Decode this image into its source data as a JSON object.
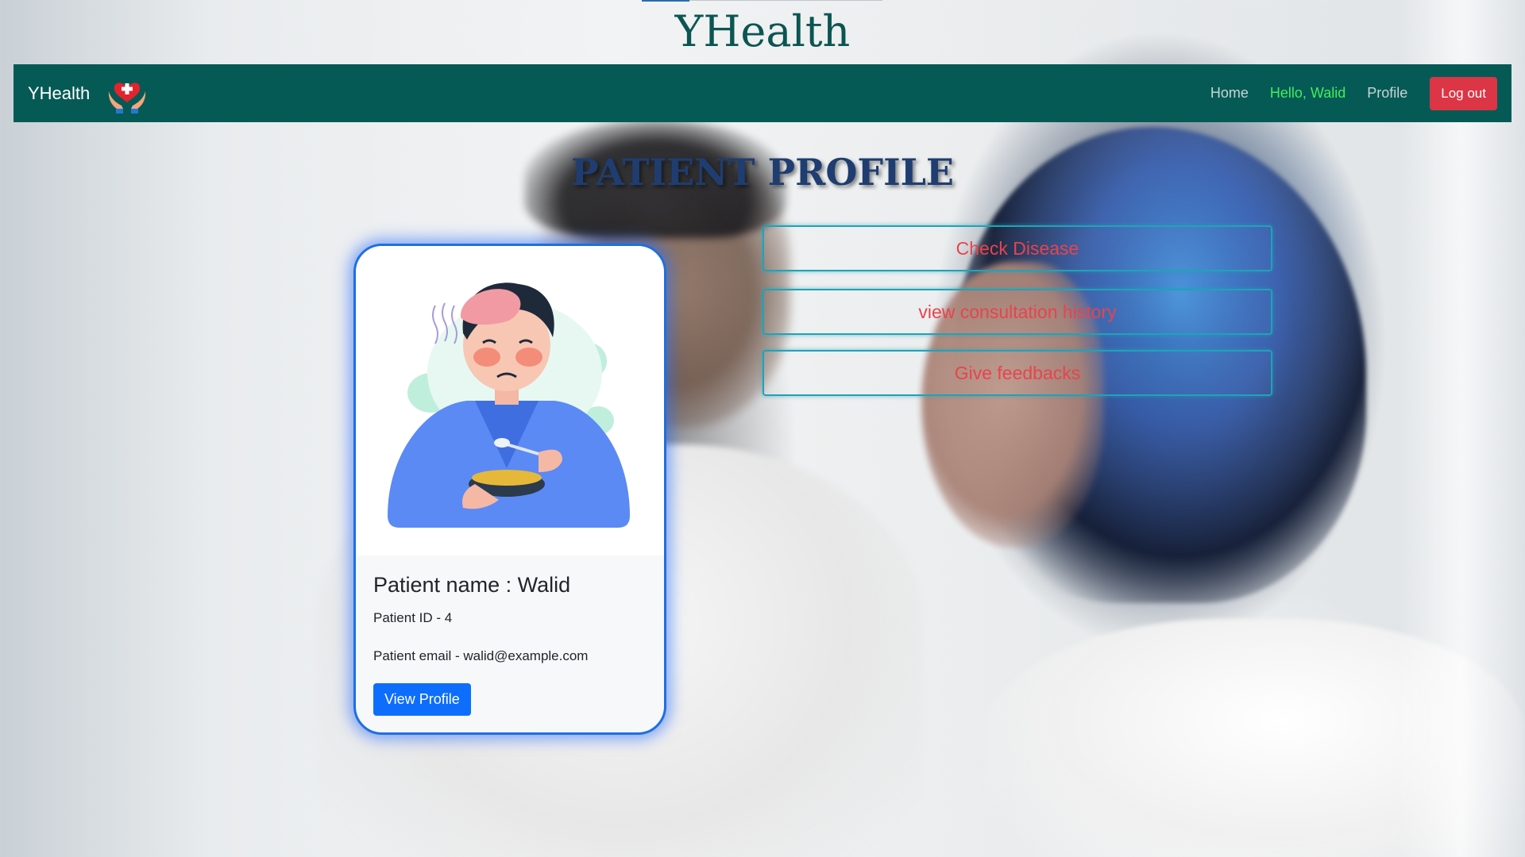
{
  "site": {
    "title": "YHealth"
  },
  "navbar": {
    "brand": "YHealth",
    "links": {
      "home": "Home",
      "greeting": "Hello, Walid",
      "profile": "Profile"
    },
    "logout_label": "Log out",
    "colors": {
      "background": "#065a56",
      "greeting": "#3ef05a",
      "logout": "#dc3545"
    }
  },
  "page": {
    "heading": "PATIENT PROFILE"
  },
  "patient_card": {
    "name_line": "Patient name : Walid",
    "id_line": "Patient ID - 4",
    "email_line": "Patient email - walid@example.com",
    "view_button": "View Profile",
    "illustration": "sick-patient-eating-soup-illustration"
  },
  "actions": {
    "check_disease": "Check Disease",
    "consultation_history": "view consultation history",
    "feedback": "Give feedbacks"
  }
}
